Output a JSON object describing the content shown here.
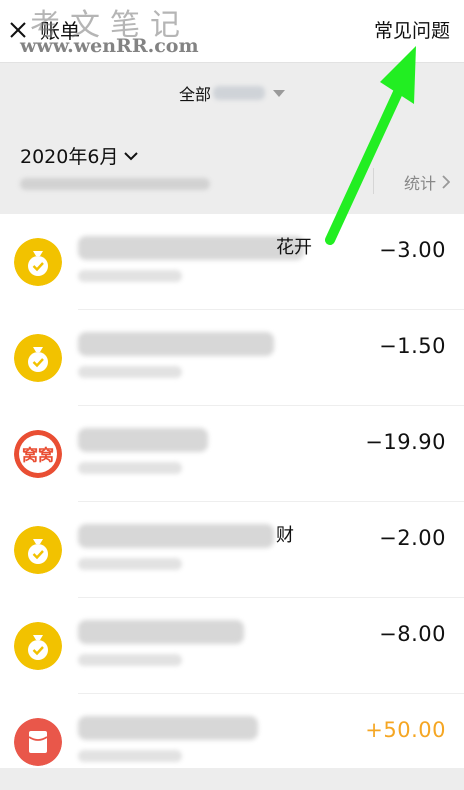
{
  "header": {
    "title": "账单",
    "faq_label": "常见问题"
  },
  "watermark": {
    "text": "考文笔记",
    "url": "www.wenRR.com"
  },
  "filter": {
    "label": "全部"
  },
  "month": {
    "label": "2020年6月"
  },
  "stats": {
    "label": "统计"
  },
  "transactions": [
    {
      "desc_suffix": "花开",
      "amount": "−3.00",
      "icon": "money-bag-icon"
    },
    {
      "desc_suffix": "",
      "amount": "−1.50",
      "icon": "money-bag-icon"
    },
    {
      "desc_suffix": "",
      "amount": "−19.90",
      "icon": "merchant-logo-icon",
      "logo_text": "窝窝"
    },
    {
      "desc_suffix": "财",
      "amount": "−2.00",
      "icon": "money-bag-icon"
    },
    {
      "desc_suffix": "",
      "amount": "−8.00",
      "icon": "money-bag-icon"
    },
    {
      "desc_suffix": "",
      "amount": "+50.00",
      "icon": "red-packet-icon"
    }
  ],
  "colors": {
    "bag_icon": "#f2c200",
    "merchant_icon": "#e94e33",
    "red_packet_icon": "#e9574a",
    "income_amount": "#f5a623",
    "annotation_arrow": "#22ee22"
  }
}
